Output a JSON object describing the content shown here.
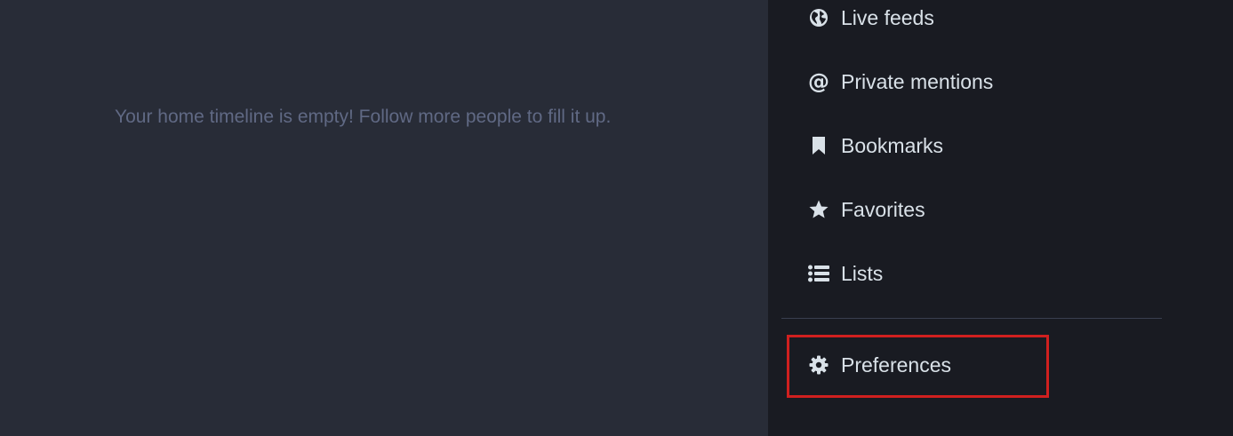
{
  "timeline": {
    "empty_message": "Your home timeline is empty! Follow more people to fill it up."
  },
  "sidebar": {
    "items": [
      {
        "label": "Live feeds",
        "icon": "globe-icon"
      },
      {
        "label": "Private mentions",
        "icon": "at-icon"
      },
      {
        "label": "Bookmarks",
        "icon": "bookmark-icon"
      },
      {
        "label": "Favorites",
        "icon": "star-icon"
      },
      {
        "label": "Lists",
        "icon": "list-icon"
      }
    ],
    "preferences": {
      "label": "Preferences",
      "icon": "gear-icon"
    }
  },
  "colors": {
    "main_background": "#282c37",
    "sidebar_background": "#191b22",
    "text": "#d9e1e8",
    "muted_text": "#606984",
    "highlight": "#d0201f"
  }
}
